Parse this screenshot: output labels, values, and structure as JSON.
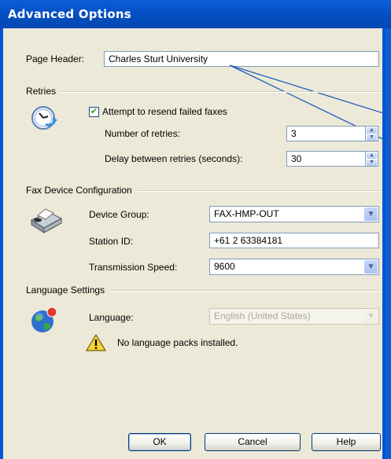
{
  "window": {
    "title": "Advanced Options"
  },
  "page_header": {
    "label": "Page Header:",
    "value": "Charles Sturt University"
  },
  "retries": {
    "section_title": "Retries",
    "resend_label": "Attempt to resend failed faxes",
    "resend_checked": true,
    "number_label": "Number of retries:",
    "number_value": "3",
    "delay_label": "Delay between retries (seconds):",
    "delay_value": "30"
  },
  "fax_device": {
    "section_title": "Fax Device Configuration",
    "device_group_label": "Device Group:",
    "device_group_value": "FAX-HMP-OUT",
    "station_id_label": "Station ID:",
    "station_id_value": "+61 2 63384181",
    "speed_label": "Transmission Speed:",
    "speed_value": "9600"
  },
  "language": {
    "section_title": "Language Settings",
    "label": "Language:",
    "value": "English (United States)",
    "warning": "No language packs installed."
  },
  "buttons": {
    "ok": "OK",
    "cancel": "Cancel",
    "help": "Help"
  },
  "colors": {
    "title_bar": "#0A5FD8",
    "dialog_bg": "#ECE9D8",
    "callout_line": "#1F5FBF"
  }
}
